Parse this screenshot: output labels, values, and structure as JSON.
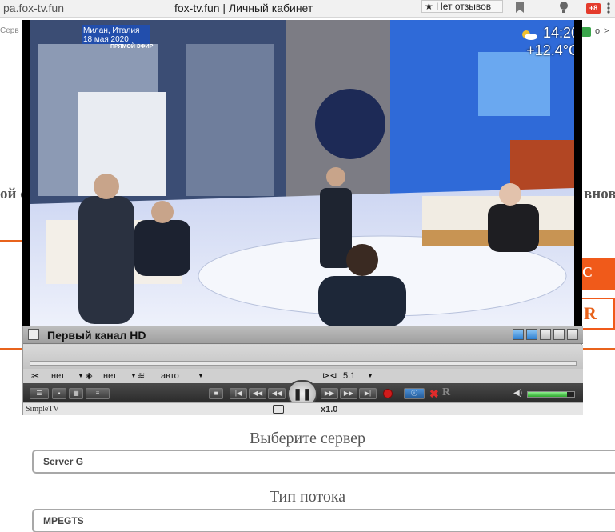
{
  "browser": {
    "url": "pa.fox-tv.fun",
    "window_title": "fox-tv.fun | Личный кабинет",
    "reviews_button": "★ Нет отзывов",
    "badge_count": "+8",
    "bookmarks_left_fragment": "Серв",
    "bookmarks_right_fragment": "o",
    "bookmarks_right_arrow": ">"
  },
  "background_page": {
    "left_text_fragment": "ой с",
    "right_text_fragment": "вновн",
    "orange_block_1": "С",
    "orange_block_2": "R"
  },
  "video": {
    "overlay_location_line1": "Милан, Италия",
    "overlay_location_line2": "18 мая 2020",
    "overlay_live": "ПРЯМОЙ ЭФИР",
    "overlay_time": "14:20",
    "overlay_temperature": "+12.4°C"
  },
  "player": {
    "channel_title": "Первый канал HD",
    "subtitle_value": "нет",
    "audio_value": "нет",
    "aspect_value": "авто",
    "sound_channels": "5.1",
    "speed": "x1.0",
    "brand": "SimpleTV",
    "volume_level": 0.85
  },
  "form": {
    "server_label": "Выберите сервер",
    "server_value": "Server G",
    "stream_label": "Тип потока",
    "stream_value": "MPEGTS"
  }
}
